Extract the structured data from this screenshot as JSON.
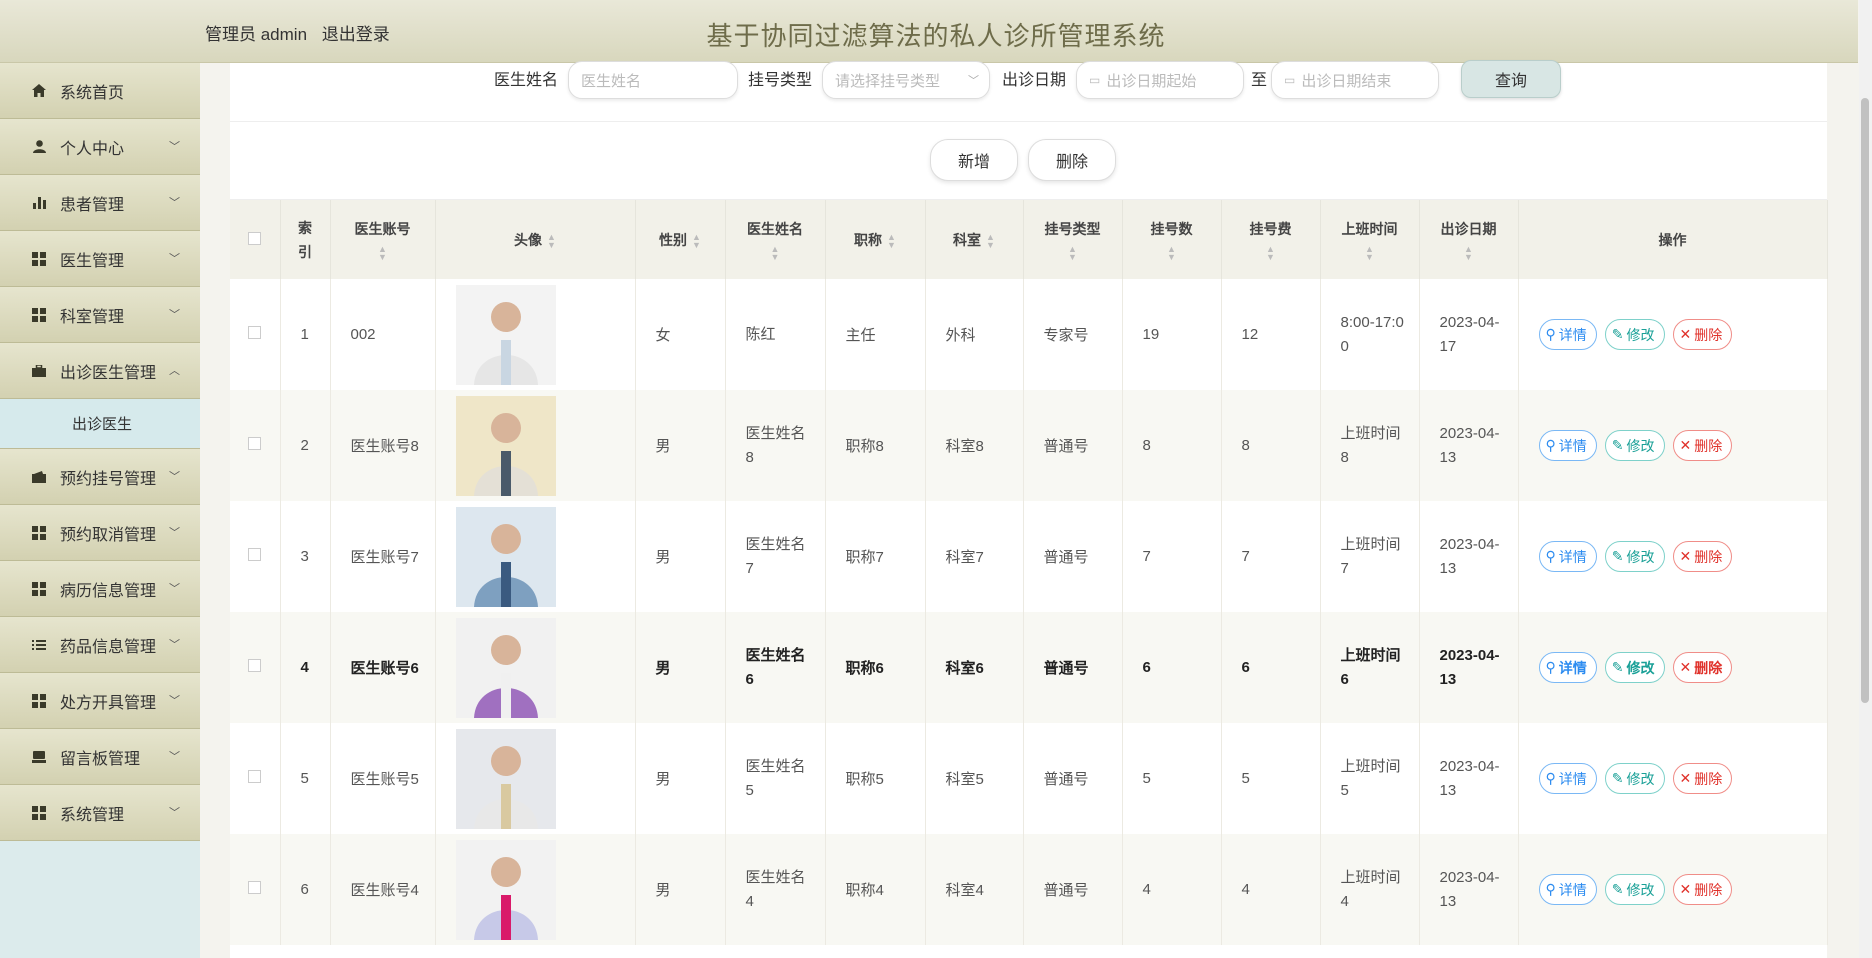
{
  "header": {
    "admin": "管理员 admin",
    "logout": "退出登录",
    "title": "基于协同过滤算法的私人诊所管理系统"
  },
  "sidebar": {
    "items": [
      {
        "label": "系统首页",
        "icon": "home-icon",
        "chev": ""
      },
      {
        "label": "个人中心",
        "icon": "user-icon",
        "chev": "﹀"
      },
      {
        "label": "患者管理",
        "icon": "bar-chart-icon",
        "chev": "﹀"
      },
      {
        "label": "医生管理",
        "icon": "grid-icon",
        "chev": "﹀"
      },
      {
        "label": "科室管理",
        "icon": "grid-icon",
        "chev": "﹀"
      },
      {
        "label": "出诊医生管理",
        "icon": "briefcase-icon",
        "chev": "︿"
      },
      {
        "label": "预约挂号管理",
        "icon": "wallet-icon",
        "chev": "﹀"
      },
      {
        "label": "预约取消管理",
        "icon": "grid-icon",
        "chev": "﹀"
      },
      {
        "label": "病历信息管理",
        "icon": "grid-icon",
        "chev": "﹀"
      },
      {
        "label": "药品信息管理",
        "icon": "list-icon",
        "chev": "﹀"
      },
      {
        "label": "处方开具管理",
        "icon": "grid-icon",
        "chev": "﹀"
      },
      {
        "label": "留言板管理",
        "icon": "drive-icon",
        "chev": "﹀"
      },
      {
        "label": "系统管理",
        "icon": "grid-icon",
        "chev": "﹀"
      }
    ],
    "sub": "出诊医生"
  },
  "search": {
    "name_label": "医生姓名",
    "name_placeholder": "医生姓名",
    "type_label": "挂号类型",
    "type_placeholder": "请选择挂号类型",
    "date_label": "出诊日期",
    "date_start": "出诊日期起始",
    "to": "至",
    "date_end": "出诊日期结束",
    "query": "查询"
  },
  "actions": {
    "add": "新增",
    "delete": "删除"
  },
  "table": {
    "headers": {
      "index": "索引",
      "account": "医生账号",
      "avatar": "头像",
      "gender": "性别",
      "name": "医生姓名",
      "title": "职称",
      "dept": "科室",
      "type": "挂号类型",
      "count": "挂号数",
      "fee": "挂号费",
      "time": "上班时间",
      "date": "出诊日期",
      "ops": "操作"
    },
    "ops": {
      "detail": "详情",
      "edit": "修改",
      "del": "删除"
    },
    "rows": [
      {
        "idx": "1",
        "account": "002",
        "gender": "女",
        "name": "陈红",
        "title": "主任",
        "dept": "外科",
        "type": "专家号",
        "count": "19",
        "fee": "12",
        "time": "8:00-17:00",
        "date": "2023-04-17"
      },
      {
        "idx": "2",
        "account": "医生账号8",
        "gender": "男",
        "name": "医生姓名8",
        "title": "职称8",
        "dept": "科室8",
        "type": "普通号",
        "count": "8",
        "fee": "8",
        "time": "上班时间8",
        "date": "2023-04-13"
      },
      {
        "idx": "3",
        "account": "医生账号7",
        "gender": "男",
        "name": "医生姓名7",
        "title": "职称7",
        "dept": "科室7",
        "type": "普通号",
        "count": "7",
        "fee": "7",
        "time": "上班时间7",
        "date": "2023-04-13"
      },
      {
        "idx": "4",
        "account": "医生账号6",
        "gender": "男",
        "name": "医生姓名6",
        "title": "职称6",
        "dept": "科室6",
        "type": "普通号",
        "count": "6",
        "fee": "6",
        "time": "上班时间6",
        "date": "2023-04-13"
      },
      {
        "idx": "5",
        "account": "医生账号5",
        "gender": "男",
        "name": "医生姓名5",
        "title": "职称5",
        "dept": "科室5",
        "type": "普通号",
        "count": "5",
        "fee": "5",
        "time": "上班时间5",
        "date": "2023-04-13"
      },
      {
        "idx": "6",
        "account": "医生账号4",
        "gender": "男",
        "name": "医生姓名4",
        "title": "职称4",
        "dept": "科室4",
        "type": "普通号",
        "count": "4",
        "fee": "4",
        "time": "上班时间4",
        "date": "2023-04-13"
      }
    ]
  },
  "colors": {
    "accent": "#6e6c4a",
    "header_bg": "#dedcc4",
    "sidebar_sub": "#d6eaec",
    "detail": "#2d8cf0",
    "edit": "#19a097",
    "delete": "#e0312a"
  }
}
